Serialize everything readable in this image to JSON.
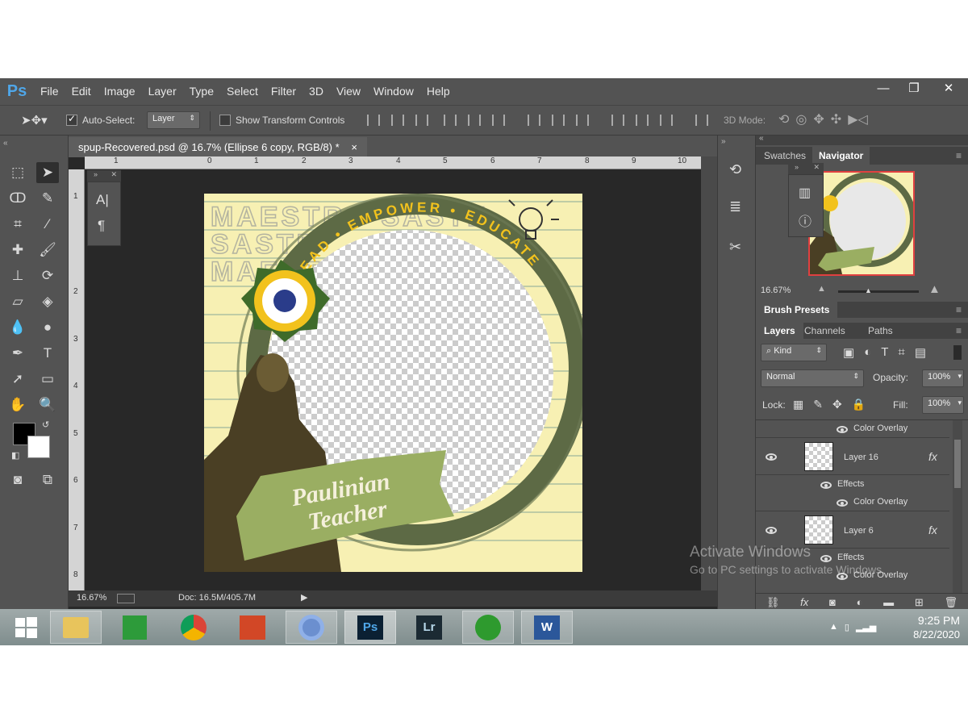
{
  "app": {
    "logo": "Ps"
  },
  "menu": [
    "File",
    "Edit",
    "Image",
    "Layer",
    "Type",
    "Select",
    "Filter",
    "3D",
    "View",
    "Window",
    "Help"
  ],
  "window_controls": {
    "minimize": "—",
    "restore": "❐",
    "close": "✕"
  },
  "options": {
    "auto_select_label": "Auto-Select:",
    "auto_select_checked": true,
    "auto_select_value": "Layer",
    "show_transform_label": "Show Transform Controls",
    "mode_3d_label": "3D Mode:"
  },
  "document": {
    "tab_title": "spup-Recovered.psd @ 16.7% (Ellipse 6 copy, RGB/8) *",
    "tab_close": "×",
    "ruler_top": [
      "1",
      "0",
      "1",
      "2",
      "3",
      "4",
      "5",
      "6",
      "7",
      "8",
      "9",
      "10"
    ],
    "ruler_left": [
      "1",
      "2",
      "3",
      "4",
      "5",
      "6",
      "7",
      "8"
    ],
    "zoom": "16.67%",
    "doc_size": "Doc: 16.5M/405.7M"
  },
  "canvas_art": {
    "bg_words": [
      "MAESTRO SASTE",
      "SASTE",
      "MAESTRO"
    ],
    "ring_text": "LEAD • EMPOWER • EDUCATE",
    "banner_line1": "Paulinian",
    "banner_line2": "Teacher",
    "colors": {
      "paper": "#f7f0b3",
      "ring": "#5d6a45",
      "banner": "#9aae62",
      "ring_text": "#f2c21d"
    }
  },
  "char_panel": {
    "a_icon": "A|",
    "para_icon": "¶"
  },
  "swatches_navigator": {
    "tabs": [
      "Swatches",
      "Navigator"
    ],
    "active_tab": "Navigator",
    "zoom": "16.67%"
  },
  "brush_presets": {
    "title": "Brush Presets"
  },
  "layers_panel": {
    "tabs": [
      "Layers",
      "Channels",
      "Paths"
    ],
    "active_tab": "Layers",
    "kind_label": "Kind",
    "blend_mode": "Normal",
    "opacity_label": "Opacity:",
    "opacity": "100%",
    "lock_label": "Lock:",
    "fill_label": "Fill:",
    "fill": "100%",
    "rows": [
      {
        "type": "effect",
        "name": "Color Overlay"
      },
      {
        "type": "layer",
        "name": "Layer 16",
        "fx": "fx"
      },
      {
        "type": "effects-header",
        "name": "Effects"
      },
      {
        "type": "effect",
        "name": "Color Overlay"
      },
      {
        "type": "layer",
        "name": "Layer 6",
        "fx": "fx"
      },
      {
        "type": "effects-header",
        "name": "Effects"
      },
      {
        "type": "effect",
        "name": "Color Overlay"
      }
    ]
  },
  "watermark": {
    "line1": "Activate Windows",
    "line2": "Go to PC settings to activate Windows."
  },
  "taskbar": {
    "apps": [
      "start",
      "file-explorer",
      "store",
      "chrome",
      "office",
      "chromium",
      "photoshop",
      "lightroom",
      "utorrent",
      "word"
    ],
    "time": "9:25 PM",
    "date": "8/22/2020"
  }
}
